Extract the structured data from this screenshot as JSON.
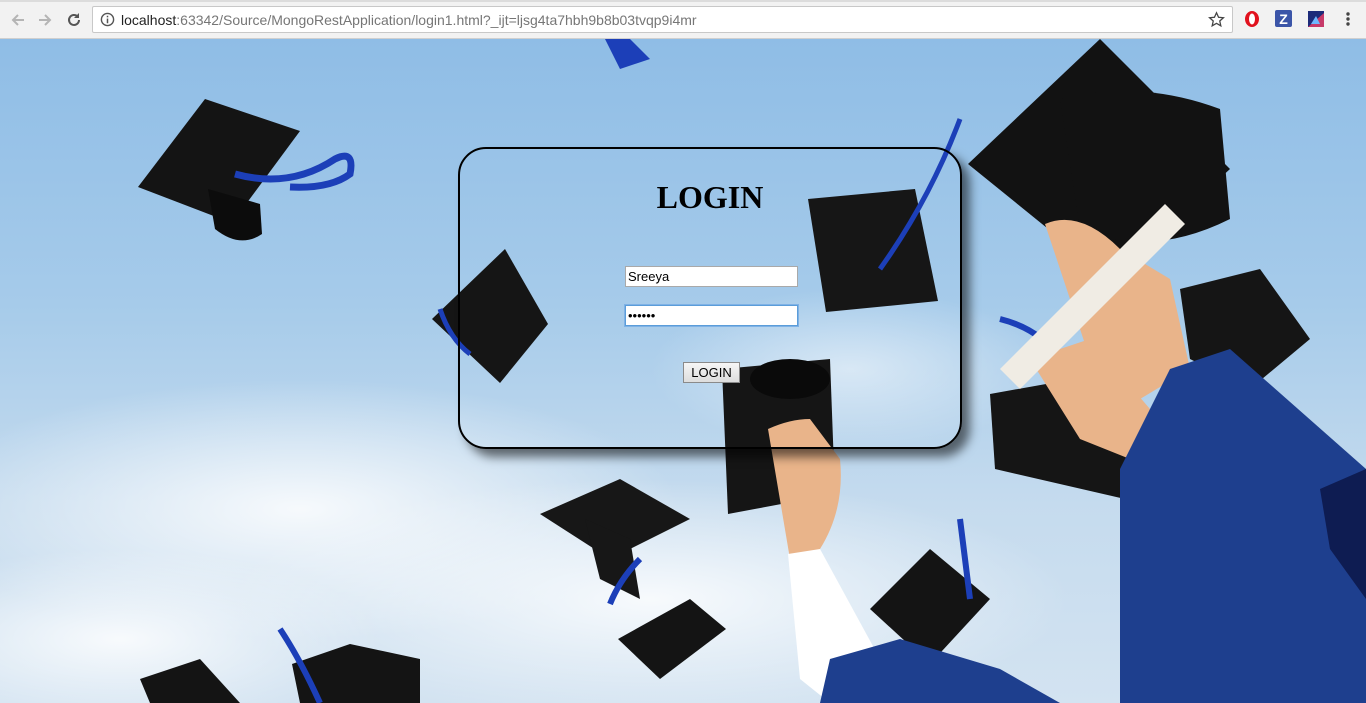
{
  "browser": {
    "url_host": "localhost",
    "url_rest": ":63342/Source/MongoRestApplication/login1.html?_ijt=ljsg4ta7hbh9b8b03tvqp9i4mr",
    "extensions": [
      {
        "name": "opera-vpn-icon"
      },
      {
        "name": "zotero-icon",
        "label": "Z"
      },
      {
        "name": "extension-icon"
      }
    ]
  },
  "login": {
    "title": "LOGIN",
    "username_value": "Sreeya",
    "password_value": "••••••",
    "button_label": "LOGIN"
  },
  "colors": {
    "sky": "#a6cbea",
    "card_border": "#000000",
    "focus_ring": "#5b9dd9"
  }
}
